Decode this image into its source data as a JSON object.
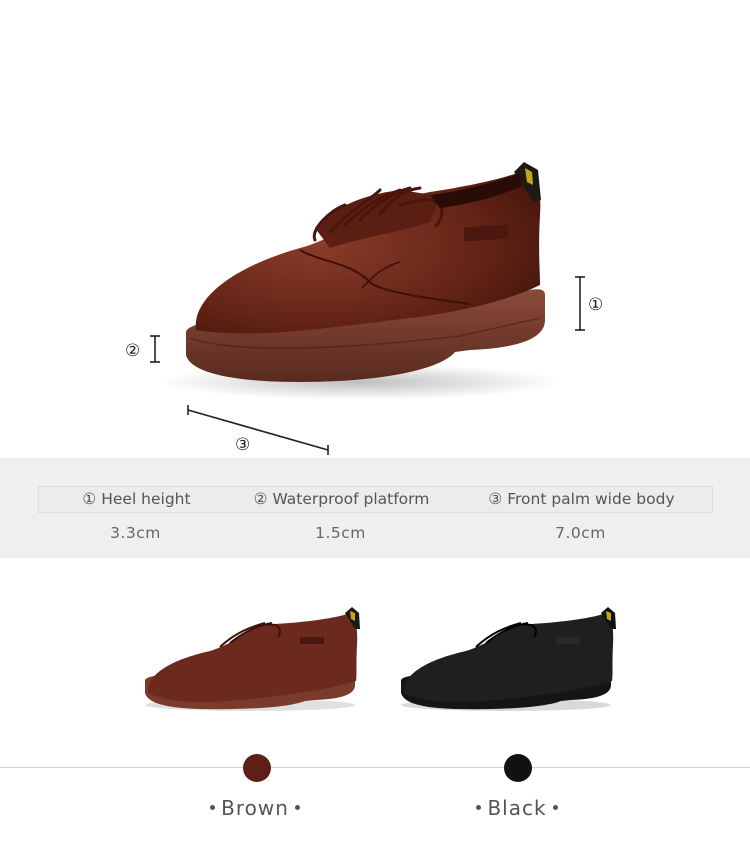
{
  "markers": {
    "heel": "①",
    "platform": "②",
    "front": "③"
  },
  "specs": {
    "headers": [
      "① Heel height",
      "② Waterproof platform",
      "③ Front palm wide body"
    ],
    "values": [
      "3.3cm",
      "1.5cm",
      "7.0cm"
    ]
  },
  "variants": [
    {
      "name": "Brown",
      "color": "#5e1f14"
    },
    {
      "name": "Black",
      "color": "#111111"
    }
  ],
  "colors": {
    "band": "#efefef",
    "leather_brown": "#6b2a1d",
    "sole_brown": "#7a3a2c",
    "leather_black": "#1a1a1a"
  }
}
